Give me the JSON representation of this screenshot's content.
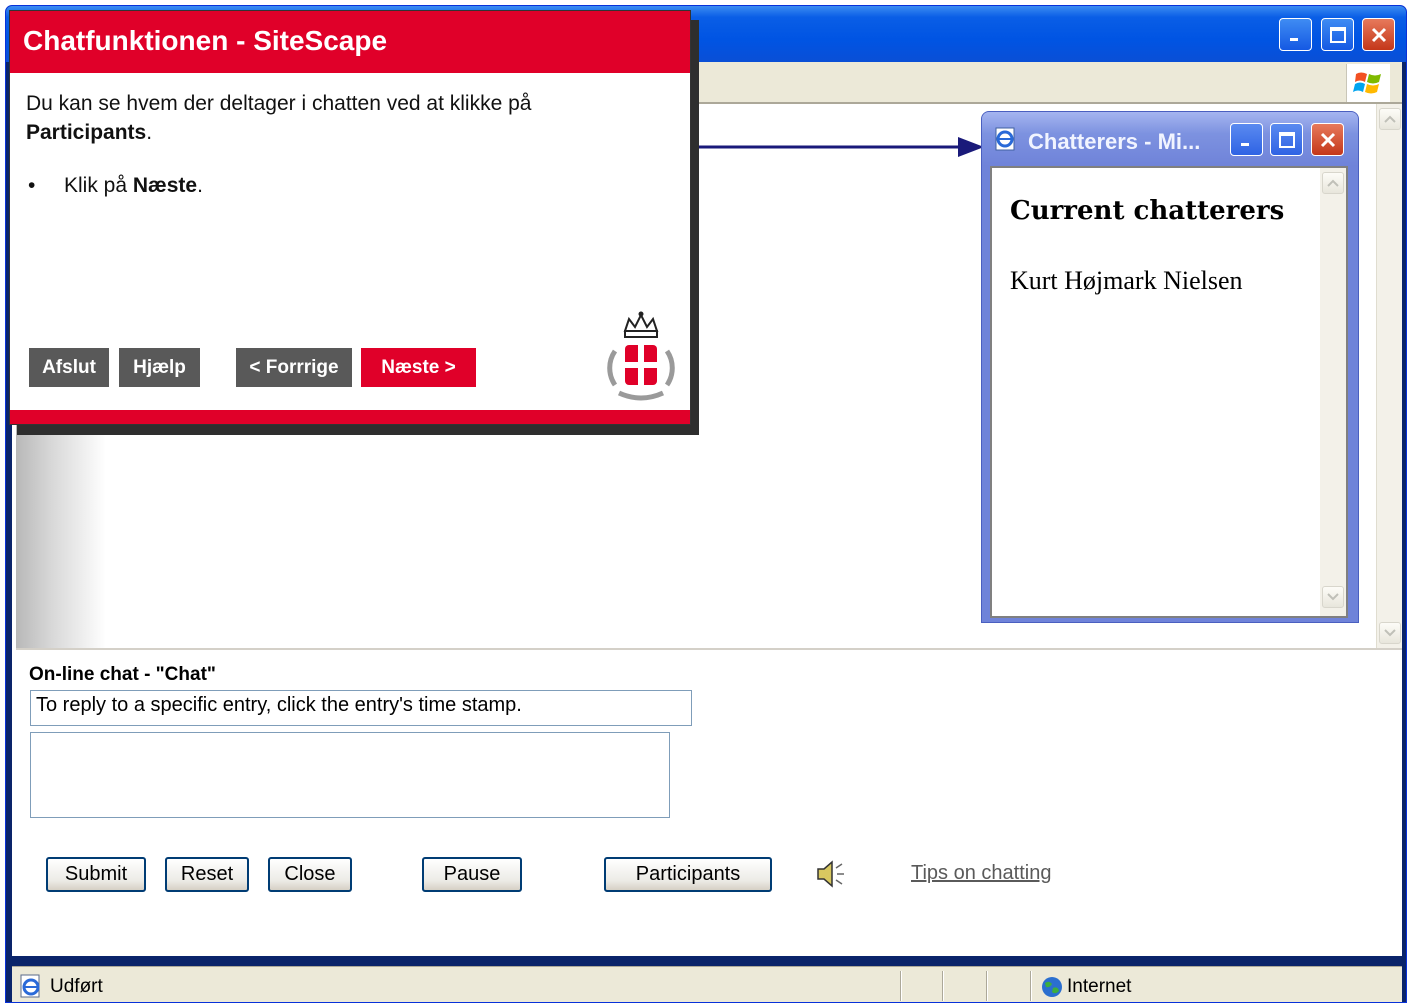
{
  "tutorial": {
    "title": "Chatfunktionen - SiteScape",
    "text_prefix": "Du kan se hvem der deltager i chatten ved at klikke på ",
    "text_bold": "Participants",
    "text_suffix": ".",
    "bullet_prefix": "Klik på ",
    "bullet_bold": "Næste",
    "bullet_suffix": ".",
    "buttons": {
      "exit": "Afslut",
      "help": "Hjælp",
      "prev": "< Forrrige",
      "next": "Næste >"
    }
  },
  "popup": {
    "title": "Chatterers - Mi...",
    "heading": "Current chatterers",
    "name": "Kurt Højmark Nielsen"
  },
  "chat": {
    "title": "On-line chat - \"Chat\"",
    "reply_hint": "To reply to a specific entry, click the entry's time stamp.",
    "message_value": "",
    "buttons": {
      "submit": "Submit",
      "reset": "Reset",
      "close": "Close",
      "pause": "Pause",
      "participants": "Participants"
    },
    "tips_link": "Tips on chatting"
  },
  "statusbar": {
    "status": "Udført",
    "zone": "Internet"
  },
  "icons": {
    "speaker": "speaker-icon",
    "ie_page": "ie-page-icon",
    "globe": "globe-icon",
    "windows_logo": "windows-logo-icon",
    "crest": "royal-crest-logo"
  },
  "colors": {
    "brand_red": "#e00029",
    "button_gray": "#595959",
    "xp_blue": "#0054e3"
  }
}
